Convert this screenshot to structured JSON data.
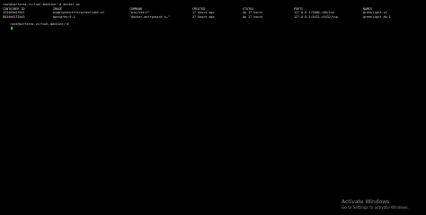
{
  "terminal": {
    "command_line": "root@sarfaraz-virtual-machine:~# docker ps",
    "prompt": "root@sarfaraz-virtual-machine:~#",
    "cursor_color": "#2bd62b",
    "headers": {
      "container_id": "CONTAINER ID",
      "image": "IMAGE",
      "command": "COMMAND",
      "created": "CREATED",
      "status": "STATUS",
      "ports": "PORTS",
      "names": "NAMES"
    },
    "rows": [
      {
        "container_id": "4344b9e0f6e1",
        "image": "bigblueshuttle/greenlight:v2",
        "command": "\"bin/start\"",
        "created": "17 hours ago",
        "status": "Up 17 hours",
        "ports": "127.0.0.1:5000->80/tcp",
        "names": "greenlight-v2"
      },
      {
        "container_id": "8034e03725d3",
        "image": "postgres:9.5",
        "command": "\"docker-entrypoint.s…\"",
        "created": "17 hours ago",
        "status": "Up 17 hours",
        "ports": "127.0.0.1:5432->5432/tcp",
        "names": "greenlight_db_1"
      }
    ]
  },
  "watermark": {
    "title": "Activate Windows",
    "subtitle": "Go to Settings to activate Windows."
  }
}
